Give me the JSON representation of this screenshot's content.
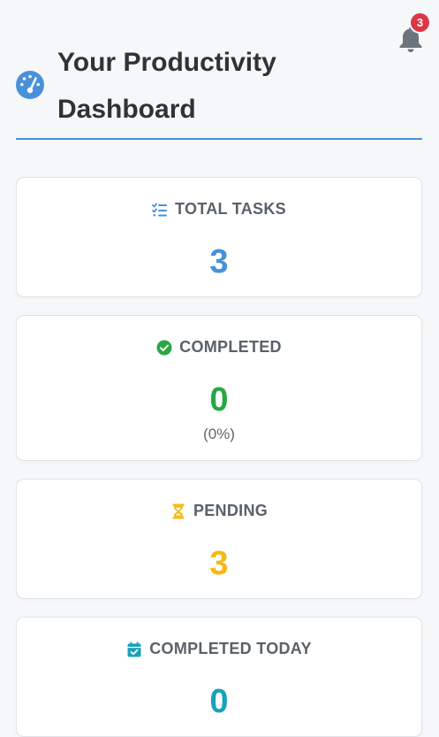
{
  "notifications": {
    "icon": "bell-icon",
    "count": "3",
    "badge_color": "#dc3545"
  },
  "header": {
    "icon": "gauge-icon",
    "title_line1": "Your Productivity",
    "title_line2": "Dashboard",
    "accent_color": "#4a90d9"
  },
  "cards": [
    {
      "icon": "task-list-icon",
      "label": "TOTAL TASKS",
      "value": "3",
      "color": "#4a90d9"
    },
    {
      "icon": "check-circle-icon",
      "label": "COMPLETED",
      "value": "0",
      "sub": "(0%)",
      "color": "#28a745"
    },
    {
      "icon": "hourglass-icon",
      "label": "PENDING",
      "value": "3",
      "color": "#f5b914"
    },
    {
      "icon": "calendar-check-icon",
      "label": "COMPLETED TODAY",
      "value": "0",
      "color": "#17a2b8"
    }
  ]
}
